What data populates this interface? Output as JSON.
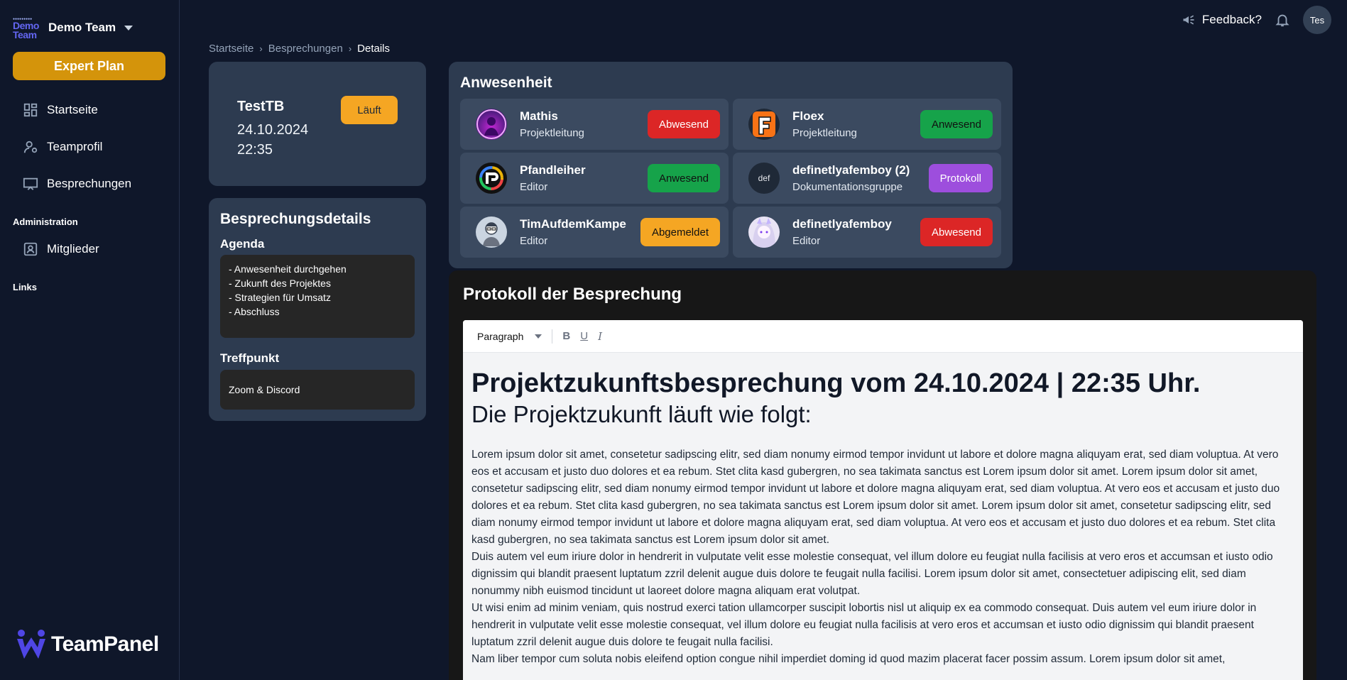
{
  "sidebar": {
    "team_logo": "Demo Team",
    "team_name": "Demo Team",
    "plan_button": "Expert Plan",
    "nav": [
      {
        "label": "Startseite",
        "icon": "dashboard-icon"
      },
      {
        "label": "Teamprofil",
        "icon": "user-icon"
      },
      {
        "label": "Besprechungen",
        "icon": "presentation-icon"
      }
    ],
    "admin_label": "Administration",
    "admin_nav": [
      {
        "label": "Mitglieder",
        "icon": "members-icon"
      }
    ],
    "links_label": "Links",
    "brand": "TeamPanel"
  },
  "topbar": {
    "feedback": "Feedback?",
    "avatar": "Tes"
  },
  "breadcrumb": [
    "Startseite",
    "Besprechungen",
    "Details"
  ],
  "meeting": {
    "title": "TestTB",
    "date": "24.10.2024",
    "time": "22:35",
    "status": "Läuft"
  },
  "details": {
    "title": "Besprechungsdetails",
    "agenda_label": "Agenda",
    "agenda": [
      "- Anwesenheit durchgehen",
      "- Zukunft des Projektes",
      "- Strategien für Umsatz",
      "- Abschluss"
    ],
    "meeting_point_label": "Treffpunkt",
    "meeting_point": "Zoom & Discord"
  },
  "attendance": {
    "title": "Anwesenheit",
    "members": [
      {
        "name": "Mathis",
        "role": "Projektleitung",
        "status": "Abwesend",
        "avatar": "purple-avatar"
      },
      {
        "name": "Floex",
        "role": "Projektleitung",
        "status": "Anwesend",
        "avatar": "f-logo-avatar"
      },
      {
        "name": "Pfandleiher",
        "role": "Editor",
        "status": "Anwesend",
        "avatar": "rainbow-avatar"
      },
      {
        "name": "definetlyafemboy (2)",
        "role": "Dokumentationsgruppe",
        "status": "Protokoll",
        "avatar_text": "def"
      },
      {
        "name": "TimAufdemKampe",
        "role": "Editor",
        "status": "Abgemeldet",
        "avatar": "person-avatar"
      },
      {
        "name": "definetlyafemboy",
        "role": "Editor",
        "status": "Abwesend",
        "avatar": "anime-avatar"
      }
    ]
  },
  "protocol": {
    "title": "Protokoll der Besprechung",
    "toolbar_format": "Paragraph",
    "bold": "B",
    "underline": "U",
    "italic": "I",
    "heading": "Projektzukunftsbesprechung vom 24.10.2024 | 22:35 Uhr.",
    "subheading": "Die Projektzukunft läuft wie folgt:",
    "paragraphs": [
      "Lorem ipsum dolor sit amet, consetetur sadipscing elitr, sed diam nonumy eirmod tempor invidunt ut labore et dolore magna aliquyam erat, sed diam voluptua. At vero eos et accusam et justo duo dolores et ea rebum. Stet clita kasd gubergren, no sea takimata sanctus est Lorem ipsum dolor sit amet. Lorem ipsum dolor sit amet, consetetur sadipscing elitr, sed diam nonumy eirmod tempor invidunt ut labore et dolore magna aliquyam erat, sed diam voluptua. At vero eos et accusam et justo duo dolores et ea rebum. Stet clita kasd gubergren, no sea takimata sanctus est Lorem ipsum dolor sit amet. Lorem ipsum dolor sit amet, consetetur sadipscing elitr, sed diam nonumy eirmod tempor invidunt ut labore et dolore magna aliquyam erat, sed diam voluptua. At vero eos et accusam et justo duo dolores et ea rebum. Stet clita kasd gubergren, no sea takimata sanctus est Lorem ipsum dolor sit amet.",
      "Duis autem vel eum iriure dolor in hendrerit in vulputate velit esse molestie consequat, vel illum dolore eu feugiat nulla facilisis at vero eros et accumsan et iusto odio dignissim qui blandit praesent luptatum zzril delenit augue duis dolore te feugait nulla facilisi. Lorem ipsum dolor sit amet, consectetuer adipiscing elit, sed diam nonummy nibh euismod tincidunt ut laoreet dolore magna aliquam erat volutpat.",
      "Ut wisi enim ad minim veniam, quis nostrud exerci tation ullamcorper suscipit lobortis nisl ut aliquip ex ea commodo consequat. Duis autem vel eum iriure dolor in hendrerit in vulputate velit esse molestie consequat, vel illum dolore eu feugiat nulla facilisis at vero eros et accumsan et iusto odio dignissim qui blandit praesent luptatum zzril delenit augue duis dolore te feugait nulla facilisi.",
      "Nam liber tempor cum soluta nobis eleifend option congue nihil imperdiet doming id quod mazim placerat facer possim assum. Lorem ipsum dolor sit amet,"
    ]
  }
}
